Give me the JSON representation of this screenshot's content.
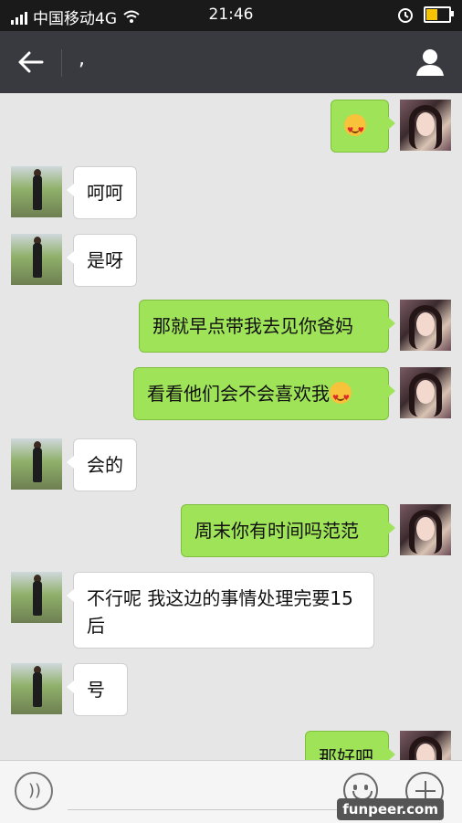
{
  "status_bar": {
    "carrier": "中国移动4G",
    "time": "21:46",
    "battery_level": 0.55,
    "battery_color": "#f6c300"
  },
  "header": {
    "title": ","
  },
  "messages": [
    {
      "side": "out",
      "text": "",
      "emoji": "heart-eyes-emoji"
    },
    {
      "side": "in",
      "text": "呵呵"
    },
    {
      "side": "in",
      "text": "是呀"
    },
    {
      "side": "out",
      "text": "那就早点带我去见你爸妈"
    },
    {
      "side": "out",
      "text": "看看他们会不会喜欢我",
      "emoji": "heart-eyes-emoji"
    },
    {
      "side": "in",
      "text": "会的"
    },
    {
      "side": "out",
      "text": "周末你有时间吗范范"
    },
    {
      "side": "in",
      "text": "不行呢 我这边的事情处理完要15后"
    },
    {
      "side": "in",
      "text": "号"
    },
    {
      "side": "out",
      "text": "那好吧"
    }
  ],
  "input_bar": {
    "voice_icon": "voice-icon",
    "emoji_icon": "emoji-icon",
    "plus_icon": "plus-icon"
  },
  "watermark": "funpeer.com",
  "colors": {
    "outgoing_bubble": "#9fe359",
    "incoming_bubble": "#ffffff",
    "title_bar": "#393a3f"
  }
}
